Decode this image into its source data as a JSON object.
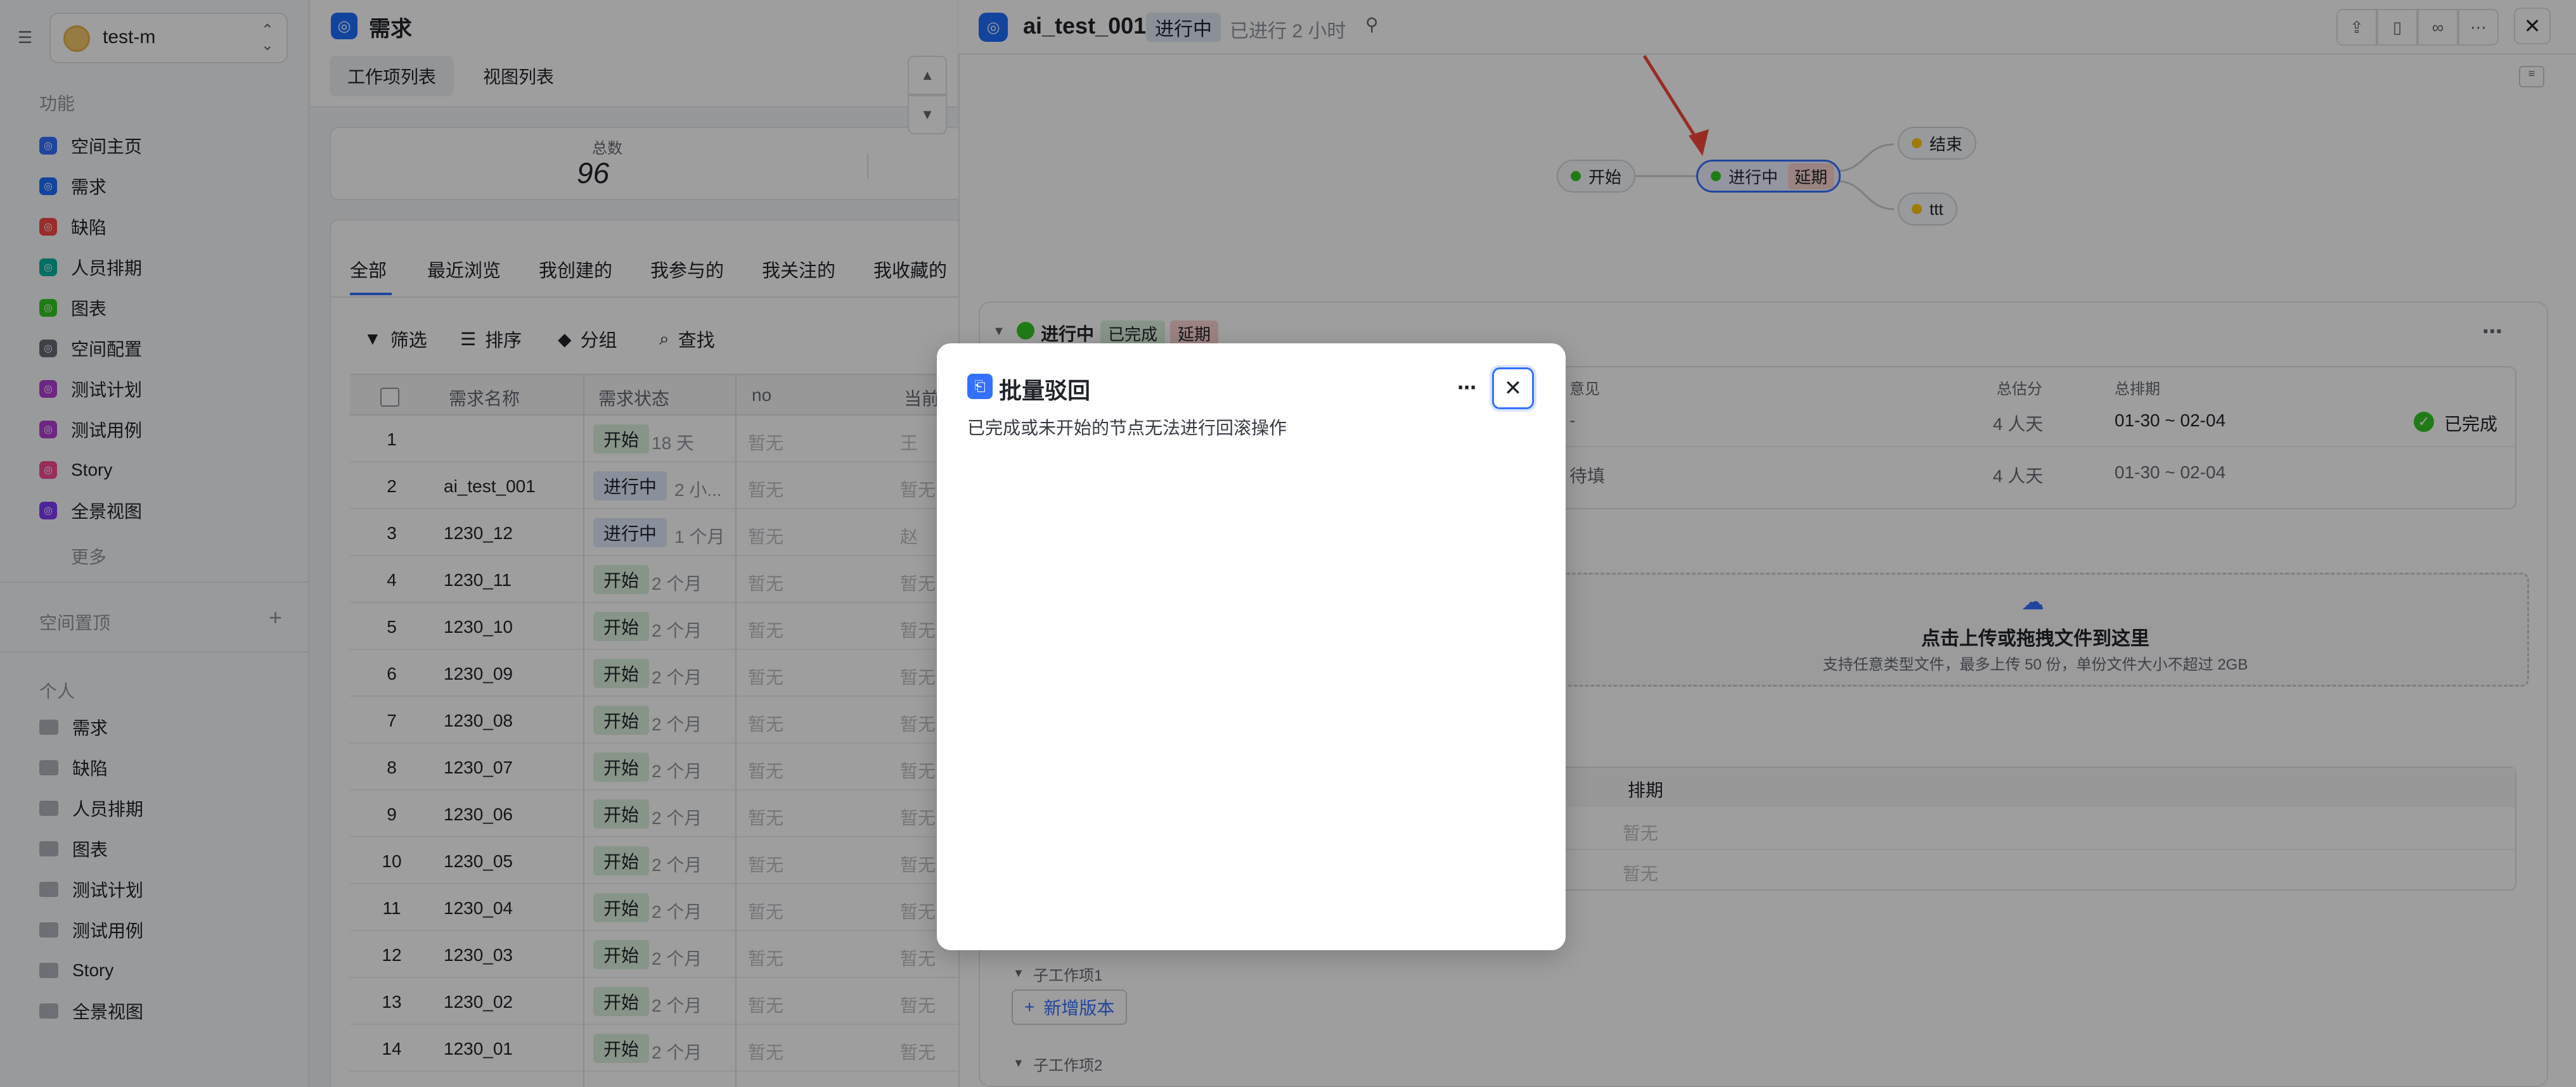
{
  "sidebar": {
    "workspace_name": "test-m",
    "section_features": "功能",
    "features": [
      {
        "label": "空间主页",
        "color": "#3370ff"
      },
      {
        "label": "需求",
        "color": "#1e6fff"
      },
      {
        "label": "缺陷",
        "color": "#f54a45"
      },
      {
        "label": "人员排期",
        "color": "#00b2a0"
      },
      {
        "label": "图表",
        "color": "#34c724"
      },
      {
        "label": "空间配置",
        "color": "#646a73"
      },
      {
        "label": "测试计划",
        "color": "#b13fd1"
      },
      {
        "label": "测试用例",
        "color": "#b13fd1"
      },
      {
        "label": "Story",
        "color": "#f54a94"
      },
      {
        "label": "全景视图",
        "color": "#7f3bf5"
      }
    ],
    "more": "更多",
    "section_pinned": "空间置顶",
    "section_personal": "个人",
    "personal": [
      "需求",
      "缺陷",
      "人员排期",
      "图表",
      "测试计划",
      "测试用例",
      "Story",
      "全景视图"
    ]
  },
  "main": {
    "title": "需求",
    "tabs": [
      "工作项列表",
      "视图列表"
    ],
    "summary_label": "总数",
    "summary_value": "96",
    "filter_tabs": [
      "全部",
      "最近浏览",
      "我创建的",
      "我参与的",
      "我关注的",
      "我收藏的"
    ],
    "tools": [
      "筛选",
      "排序",
      "分组",
      "查找"
    ],
    "columns": [
      "需求名称",
      "需求状态",
      "no",
      "当前"
    ],
    "rows": [
      {
        "num": "1",
        "name": "",
        "status": "开始",
        "dur": "18 天",
        "no": "暂无",
        "cur": "王"
      },
      {
        "num": "2",
        "name": "ai_test_001",
        "status": "进行中",
        "dur": "2 小...",
        "no": "暂无",
        "cur": "暂无"
      },
      {
        "num": "3",
        "name": "1230_12",
        "status": "进行中",
        "dur": "1 个月",
        "no": "暂无",
        "cur": "赵"
      },
      {
        "num": "4",
        "name": "1230_11",
        "status": "开始",
        "dur": "2 个月",
        "no": "暂无",
        "cur": "暂无"
      },
      {
        "num": "5",
        "name": "1230_10",
        "status": "开始",
        "dur": "2 个月",
        "no": "暂无",
        "cur": "暂无"
      },
      {
        "num": "6",
        "name": "1230_09",
        "status": "开始",
        "dur": "2 个月",
        "no": "暂无",
        "cur": "暂无"
      },
      {
        "num": "7",
        "name": "1230_08",
        "status": "开始",
        "dur": "2 个月",
        "no": "暂无",
        "cur": "暂无"
      },
      {
        "num": "8",
        "name": "1230_07",
        "status": "开始",
        "dur": "2 个月",
        "no": "暂无",
        "cur": "暂无"
      },
      {
        "num": "9",
        "name": "1230_06",
        "status": "开始",
        "dur": "2 个月",
        "no": "暂无",
        "cur": "暂无"
      },
      {
        "num": "10",
        "name": "1230_05",
        "status": "开始",
        "dur": "2 个月",
        "no": "暂无",
        "cur": "暂无"
      },
      {
        "num": "11",
        "name": "1230_04",
        "status": "开始",
        "dur": "2 个月",
        "no": "暂无",
        "cur": "暂无"
      },
      {
        "num": "12",
        "name": "1230_03",
        "status": "开始",
        "dur": "2 个月",
        "no": "暂无",
        "cur": "暂无"
      },
      {
        "num": "13",
        "name": "1230_02",
        "status": "开始",
        "dur": "2 个月",
        "no": "暂无",
        "cur": "暂无"
      },
      {
        "num": "14",
        "name": "1230_01",
        "status": "开始",
        "dur": "2 个月",
        "no": "暂无",
        "cur": "暂无"
      }
    ]
  },
  "detail": {
    "title": "ai_test_001",
    "status": "进行中",
    "elapsed": "已进行 2 小时",
    "flow": {
      "start": "开始",
      "current": "进行中",
      "delay": "延期",
      "end": "结束",
      "ttt": "ttt"
    },
    "node_header": {
      "name": "进行中",
      "done": "已完成",
      "delay": "延期"
    },
    "cols": {
      "opinion": "意见",
      "estimate": "总估分",
      "schedule": "总排期"
    },
    "row1": {
      "opinion": "-",
      "estimate": "4 人天",
      "schedule": "01-30 ~ 02-04",
      "state": "已完成"
    },
    "row2": {
      "opinion": "待填",
      "estimate": "4 人天",
      "schedule": "01-30 ~ 02-04"
    },
    "upload_title": "点击上传或拖拽文件到这里",
    "upload_sub": "支持任意类型文件，最多上传 50 份，单份文件大小不超过 2GB",
    "sched_col": "排期",
    "sched_vals": [
      "暂无",
      "暂无"
    ],
    "sub1": "子工作项1",
    "add_version": "新增版本",
    "sub2": "子工作项2"
  },
  "modal": {
    "title": "批量驳回",
    "desc": "已完成或未开始的节点无法进行回滚操作"
  }
}
